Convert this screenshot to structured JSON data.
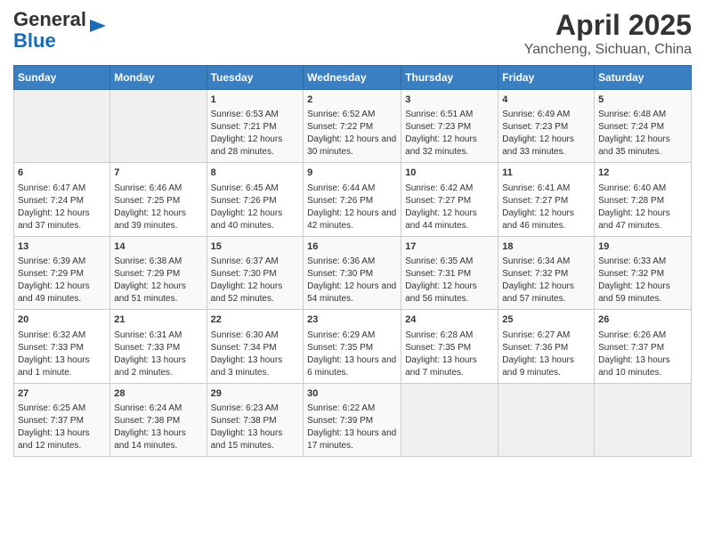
{
  "header": {
    "logo_line1": "General",
    "logo_line2": "Blue",
    "title": "April 2025",
    "subtitle": "Yancheng, Sichuan, China"
  },
  "days_of_week": [
    "Sunday",
    "Monday",
    "Tuesday",
    "Wednesday",
    "Thursday",
    "Friday",
    "Saturday"
  ],
  "weeks": [
    [
      {
        "day": "",
        "content": ""
      },
      {
        "day": "",
        "content": ""
      },
      {
        "day": "1",
        "content": "Sunrise: 6:53 AM\nSunset: 7:21 PM\nDaylight: 12 hours and 28 minutes."
      },
      {
        "day": "2",
        "content": "Sunrise: 6:52 AM\nSunset: 7:22 PM\nDaylight: 12 hours and 30 minutes."
      },
      {
        "day": "3",
        "content": "Sunrise: 6:51 AM\nSunset: 7:23 PM\nDaylight: 12 hours and 32 minutes."
      },
      {
        "day": "4",
        "content": "Sunrise: 6:49 AM\nSunset: 7:23 PM\nDaylight: 12 hours and 33 minutes."
      },
      {
        "day": "5",
        "content": "Sunrise: 6:48 AM\nSunset: 7:24 PM\nDaylight: 12 hours and 35 minutes."
      }
    ],
    [
      {
        "day": "6",
        "content": "Sunrise: 6:47 AM\nSunset: 7:24 PM\nDaylight: 12 hours and 37 minutes."
      },
      {
        "day": "7",
        "content": "Sunrise: 6:46 AM\nSunset: 7:25 PM\nDaylight: 12 hours and 39 minutes."
      },
      {
        "day": "8",
        "content": "Sunrise: 6:45 AM\nSunset: 7:26 PM\nDaylight: 12 hours and 40 minutes."
      },
      {
        "day": "9",
        "content": "Sunrise: 6:44 AM\nSunset: 7:26 PM\nDaylight: 12 hours and 42 minutes."
      },
      {
        "day": "10",
        "content": "Sunrise: 6:42 AM\nSunset: 7:27 PM\nDaylight: 12 hours and 44 minutes."
      },
      {
        "day": "11",
        "content": "Sunrise: 6:41 AM\nSunset: 7:27 PM\nDaylight: 12 hours and 46 minutes."
      },
      {
        "day": "12",
        "content": "Sunrise: 6:40 AM\nSunset: 7:28 PM\nDaylight: 12 hours and 47 minutes."
      }
    ],
    [
      {
        "day": "13",
        "content": "Sunrise: 6:39 AM\nSunset: 7:29 PM\nDaylight: 12 hours and 49 minutes."
      },
      {
        "day": "14",
        "content": "Sunrise: 6:38 AM\nSunset: 7:29 PM\nDaylight: 12 hours and 51 minutes."
      },
      {
        "day": "15",
        "content": "Sunrise: 6:37 AM\nSunset: 7:30 PM\nDaylight: 12 hours and 52 minutes."
      },
      {
        "day": "16",
        "content": "Sunrise: 6:36 AM\nSunset: 7:30 PM\nDaylight: 12 hours and 54 minutes."
      },
      {
        "day": "17",
        "content": "Sunrise: 6:35 AM\nSunset: 7:31 PM\nDaylight: 12 hours and 56 minutes."
      },
      {
        "day": "18",
        "content": "Sunrise: 6:34 AM\nSunset: 7:32 PM\nDaylight: 12 hours and 57 minutes."
      },
      {
        "day": "19",
        "content": "Sunrise: 6:33 AM\nSunset: 7:32 PM\nDaylight: 12 hours and 59 minutes."
      }
    ],
    [
      {
        "day": "20",
        "content": "Sunrise: 6:32 AM\nSunset: 7:33 PM\nDaylight: 13 hours and 1 minute."
      },
      {
        "day": "21",
        "content": "Sunrise: 6:31 AM\nSunset: 7:33 PM\nDaylight: 13 hours and 2 minutes."
      },
      {
        "day": "22",
        "content": "Sunrise: 6:30 AM\nSunset: 7:34 PM\nDaylight: 13 hours and 3 minutes."
      },
      {
        "day": "23",
        "content": "Sunrise: 6:29 AM\nSunset: 7:35 PM\nDaylight: 13 hours and 6 minutes."
      },
      {
        "day": "24",
        "content": "Sunrise: 6:28 AM\nSunset: 7:35 PM\nDaylight: 13 hours and 7 minutes."
      },
      {
        "day": "25",
        "content": "Sunrise: 6:27 AM\nSunset: 7:36 PM\nDaylight: 13 hours and 9 minutes."
      },
      {
        "day": "26",
        "content": "Sunrise: 6:26 AM\nSunset: 7:37 PM\nDaylight: 13 hours and 10 minutes."
      }
    ],
    [
      {
        "day": "27",
        "content": "Sunrise: 6:25 AM\nSunset: 7:37 PM\nDaylight: 13 hours and 12 minutes."
      },
      {
        "day": "28",
        "content": "Sunrise: 6:24 AM\nSunset: 7:38 PM\nDaylight: 13 hours and 14 minutes."
      },
      {
        "day": "29",
        "content": "Sunrise: 6:23 AM\nSunset: 7:38 PM\nDaylight: 13 hours and 15 minutes."
      },
      {
        "day": "30",
        "content": "Sunrise: 6:22 AM\nSunset: 7:39 PM\nDaylight: 13 hours and 17 minutes."
      },
      {
        "day": "",
        "content": ""
      },
      {
        "day": "",
        "content": ""
      },
      {
        "day": "",
        "content": ""
      }
    ]
  ]
}
